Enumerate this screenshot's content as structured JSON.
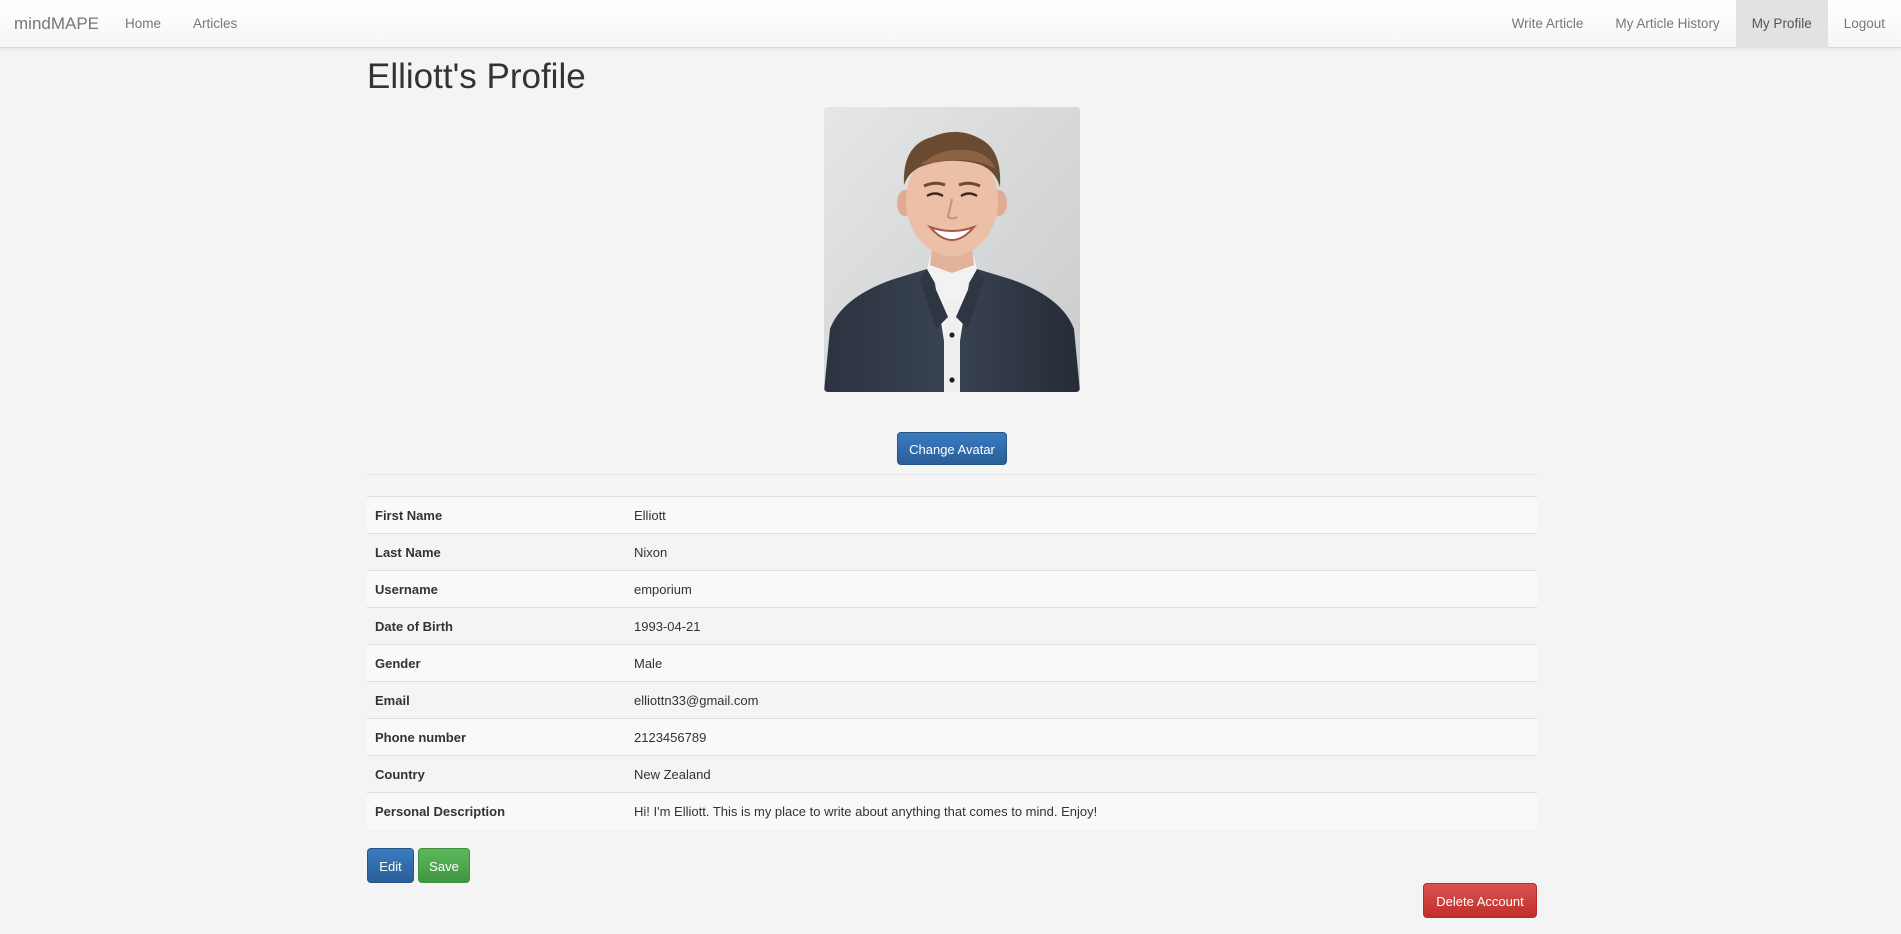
{
  "navbar": {
    "brand": "mindMAPE",
    "left_links": [
      "Home",
      "Articles"
    ],
    "right_links": [
      "Write Article",
      "My Article History",
      "My Profile",
      "Logout"
    ],
    "active": "My Profile"
  },
  "page": {
    "title": "Elliott's Profile",
    "change_avatar_label": "Change Avatar",
    "edit_label": "Edit",
    "save_label": "Save",
    "delete_label": "Delete Account"
  },
  "profile": [
    {
      "label": "First Name",
      "value": "Elliott"
    },
    {
      "label": "Last Name",
      "value": "Nixon"
    },
    {
      "label": "Username",
      "value": "emporium"
    },
    {
      "label": "Date of Birth",
      "value": "1993-04-21"
    },
    {
      "label": "Gender",
      "value": "Male"
    },
    {
      "label": "Email",
      "value": "elliottn33@gmail.com"
    },
    {
      "label": "Phone number",
      "value": "2123456789"
    },
    {
      "label": "Country",
      "value": "New Zealand"
    },
    {
      "label": "Personal Description",
      "value": "Hi! I'm Elliott. This is my place to write about anything that comes to mind. Enjoy!"
    }
  ],
  "colors": {
    "primary": "#2f6aa8",
    "success": "#4cae4c",
    "danger": "#d43f3a",
    "page_bg": "#f4f4f4"
  }
}
